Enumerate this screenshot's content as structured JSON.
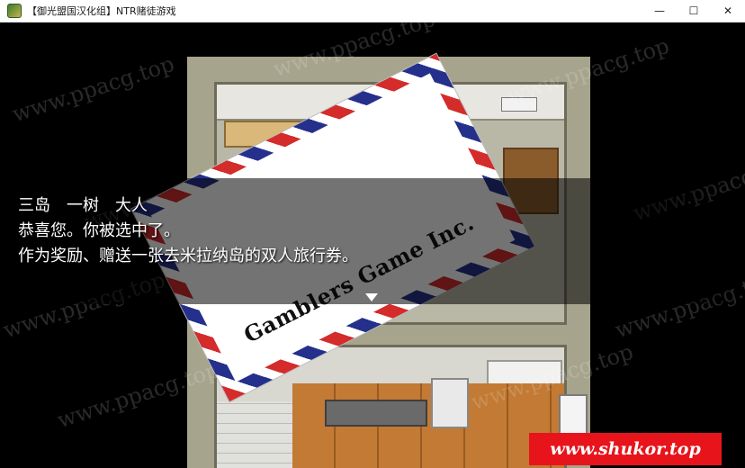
{
  "window": {
    "title": "【御光盟国汉化组】NTR赌徒游戏",
    "minimize_glyph": "—",
    "maximize_glyph": "☐",
    "close_glyph": "✕"
  },
  "envelope": {
    "text": "Gamblers Game Inc."
  },
  "message": {
    "speaker": "三岛　一树　大人",
    "line2": "恭喜您。你被选中了。",
    "line3": "作为奖励、赠送一张去米拉纳岛的双人旅行券。"
  },
  "watermark": {
    "text": "www.ppacg.top"
  },
  "badge": {
    "text": "www.shukor.top",
    "color": "#e8141b"
  },
  "colors": {
    "stripe_red": "#d42b2b",
    "stripe_blue": "#25308c"
  }
}
